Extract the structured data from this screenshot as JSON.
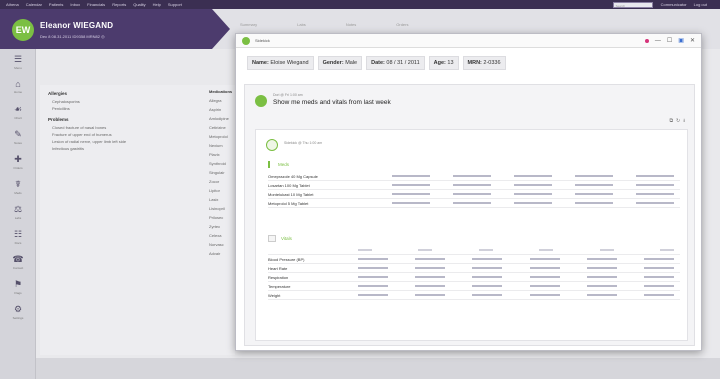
{
  "topbar": {
    "items": [
      "Athena",
      "Calendar",
      "Patients",
      "Inbox",
      "Financials",
      "Reports",
      "Quality",
      "Help",
      "Support"
    ],
    "right": [
      "Search",
      "Communicator",
      "Log out"
    ]
  },
  "patient": {
    "initials": "EW",
    "banner_name": "Eleanor WIEGAND",
    "banner_detail": "Dec 8   08.31.2011   ID9358   MRN82  ◎"
  },
  "crumbs": [
    "Summary",
    "Labs",
    "Notes",
    "Orders"
  ],
  "sidebar": {
    "items": [
      {
        "icon": "☰",
        "label": "Menu"
      },
      {
        "icon": "⌂",
        "label": "Home"
      },
      {
        "icon": "☙",
        "label": "Chart"
      },
      {
        "icon": "✎",
        "label": "Notes"
      },
      {
        "icon": "✚",
        "label": "Orders"
      },
      {
        "icon": "☤",
        "label": "Meds"
      },
      {
        "icon": "⚖",
        "label": "Labs"
      },
      {
        "icon": "☷",
        "label": "Docs"
      },
      {
        "icon": "☎",
        "label": "Contact"
      },
      {
        "icon": "⚑",
        "label": "Flags"
      },
      {
        "icon": "⚙",
        "label": "Settings"
      }
    ]
  },
  "background": {
    "allergies_title": "Allergies",
    "allergies": [
      "Cephalosporins",
      "Penicillins"
    ],
    "problems_title": "Problems",
    "problems": [
      "Closed fracture of nasal bones",
      "Fracture of upper end of humerus",
      "Lesion of radial nerve, upper limb left side",
      "Infectious gastritis"
    ],
    "meds_title": "Medications",
    "meds": [
      "Allegra",
      "Aspirin",
      "Amlodipine",
      "Cetirizine",
      "Metoprolol",
      "Nexium",
      "Plavix",
      "Synthroid",
      "Singulair",
      "Zocor",
      "Lipitor",
      "Lasix",
      "Lisinopril",
      "Prilosec",
      "Zyrtec",
      "Celexa",
      "Norvasc",
      "Advair"
    ]
  },
  "dialog": {
    "title": "Sidekick",
    "controls": [
      "—",
      "☐",
      "▣",
      "✕"
    ],
    "patient_info": [
      {
        "label": "Name:",
        "value": "Eloise Wiegand"
      },
      {
        "label": "Gender:",
        "value": "Male"
      },
      {
        "label": "Date:",
        "value": "08 / 31 / 2011"
      },
      {
        "label": "Age:",
        "value": "13"
      },
      {
        "label": "MRN:",
        "value": "2-0336"
      }
    ],
    "question_meta": "Dori @ Fri 1:00 am",
    "question": "Show me meds and vitals from last week",
    "tool_icons": [
      "⧉",
      "↻",
      "⭳"
    ],
    "answer_meta": "Sidekick @ Thu 1:00 am",
    "meds_section": {
      "title": "Meds",
      "rows": [
        {
          "label": "Omeprazole 40 Mg Capsule"
        },
        {
          "label": "Losartan 100 Mg Tablet"
        },
        {
          "label": "Montelukast 10 Mg Tablet"
        },
        {
          "label": "Metoprolol 5 Mg Tablet"
        }
      ]
    },
    "labs_section": {
      "title": "Vitals",
      "rows": [
        {
          "label": "Blood Pressure (BP)"
        },
        {
          "label": "Heart Rate"
        },
        {
          "label": "Respiration"
        },
        {
          "label": "Temperature"
        },
        {
          "label": "Weight"
        }
      ]
    }
  }
}
